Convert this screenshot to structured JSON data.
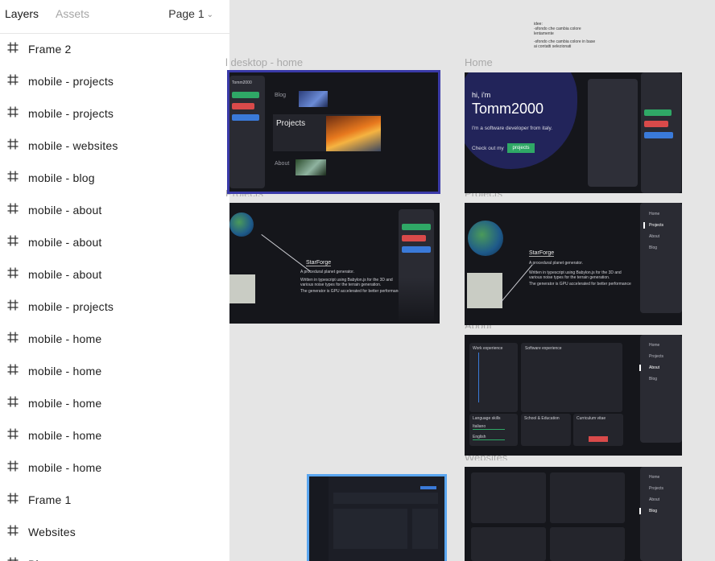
{
  "panel": {
    "tabs": [
      "Layers",
      "Assets"
    ],
    "page": "Page 1",
    "layers": [
      "Frame 2",
      "mobile - projects",
      "mobile - projects",
      "mobile - websites",
      "mobile - blog",
      "mobile - about",
      "mobile - about",
      "mobile - about",
      "mobile - projects",
      "mobile - home",
      "mobile - home",
      "mobile - home",
      "mobile - home",
      "mobile - home",
      "Frame 1",
      "Websites",
      "Bl..."
    ]
  },
  "canvas": {
    "labels": {
      "desktop_home": "desktop - home",
      "home": "Home",
      "projects_left": "Projects",
      "projects_right": "Projects",
      "about": "About",
      "websites": "Websites"
    },
    "notes": [
      "idee:",
      "-sfondo che cambia colore",
      "lentamente",
      "-sfondo che cambia colore in base",
      "ai contatti selezionati"
    ],
    "desktop_home": {
      "blog": "Blog",
      "projects": "Projects",
      "about": "About",
      "user": "Tomm2000"
    },
    "home": {
      "greeting": "hi, i'm",
      "name": "Tomm2000",
      "tagline": "I'm a software developer from italy.",
      "cta": "Check out my",
      "cta_button": "projects"
    },
    "project": {
      "title": "StarForge",
      "subtitle": "A procedural planet generator.",
      "desc1": "Written in typescript using Babylon.js for the 3D and",
      "desc2": "various noise types for the terrain generation.",
      "desc3": "The generator is GPU accelerated for better performance"
    },
    "nav": [
      "Home",
      "Projects",
      "About",
      "Blog"
    ],
    "about": {
      "work": "Work experience",
      "software": "Software experience",
      "languages": "Language skills",
      "school": "School & Education",
      "cv": "Curriculum vitae",
      "italiano": "Italiano",
      "english": "English"
    },
    "colors": {
      "green": "#2fa866",
      "red": "#d94a4a",
      "blue": "#3a7ad9",
      "frame_bg": "#15161b",
      "selection": "#3a3aa8"
    }
  }
}
